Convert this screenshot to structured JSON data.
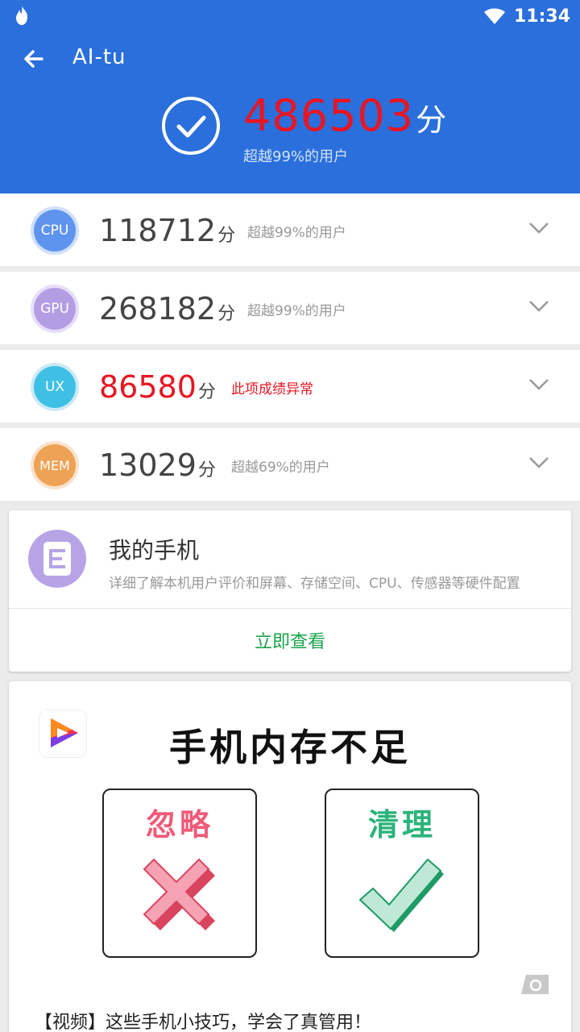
{
  "status_bar": {
    "time": "11:34"
  },
  "header": {
    "title": "AI-tu",
    "total_score": "486503",
    "score_unit": "分",
    "total_sub": "超越99%的用户"
  },
  "rows": [
    {
      "badge": "CPU",
      "score": "118712",
      "unit": "分",
      "desc": "超越99%的用户",
      "badge_outer": "#cfe0fb",
      "badge_inner": "#5f94ee",
      "warn": false
    },
    {
      "badge": "GPU",
      "score": "268182",
      "unit": "分",
      "desc": "超越99%的用户",
      "badge_outer": "#e7defa",
      "badge_inner": "#b49ee3",
      "warn": false
    },
    {
      "badge": "UX",
      "score": "86580",
      "unit": "分",
      "desc": "此项成绩异常",
      "badge_outer": "#cbeaf6",
      "badge_inner": "#3ec0e4",
      "warn": true
    },
    {
      "badge": "MEM",
      "score": "13029",
      "unit": "分",
      "desc": "超越69%的用户",
      "badge_outer": "#fbe2cc",
      "badge_inner": "#eea256",
      "warn": false
    }
  ],
  "my_phone_card": {
    "title": "我的手机",
    "subtitle": "详细了解本机用户评价和屏幕、存储空间、CPU、传感器等硬件配置",
    "action": "立即查看"
  },
  "ad_card": {
    "title": "手机内存不足",
    "ignore_label": "忽略",
    "clean_label": "清理",
    "caption": "【视频】这些手机小技巧，学会了真管用！"
  },
  "colors": {
    "header_bg": "#2a6fdc",
    "warn_red": "#e81522",
    "action_green": "#1aa34a"
  }
}
